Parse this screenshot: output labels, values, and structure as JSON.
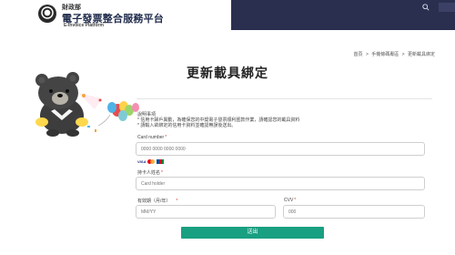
{
  "header": {
    "agency": "財政部",
    "platform_name": "電子發票整合服務平台",
    "platform_name_en": "E-Invoice Platform",
    "search_icon": "search-icon",
    "colors": {
      "dark_band": "#2b2f4f",
      "accent": "#199f81"
    }
  },
  "breadcrumb": {
    "items": [
      "首頁",
      "手機條碼專區",
      "更新載具綁定"
    ],
    "separator": ">"
  },
  "page": {
    "title": "更新載具綁定"
  },
  "notes": {
    "title": "說明事項",
    "lines": [
      "* 信用卡歸戶異動，為確保您的中獎電子發票順利匯款作業，請確認您的載具資料",
      "* 請輸入欲綁定的信用卡資料並確認無誤後送出。"
    ]
  },
  "form": {
    "card_number_label": "Card number",
    "card_number_placeholder": "0000 0000 0000 0000",
    "card_brands": [
      "VISA",
      "Mastercard",
      "JCB"
    ],
    "holder_label": "持卡人姓名",
    "holder_placeholder": "Card holder",
    "expiry_label": "有效期（月/年）",
    "expiry_placeholder": "MM/YY",
    "cvv_label": "CVV",
    "cvv_placeholder": "000",
    "required_mark": "*",
    "submit_label": "送出"
  }
}
